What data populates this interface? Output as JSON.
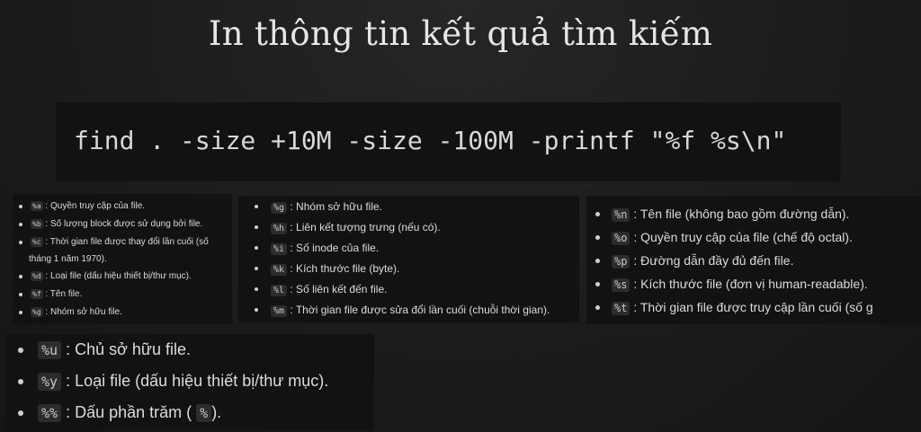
{
  "title": "In thông tin kết quả tìm kiếm",
  "command": "find . -size +10M -size -100M -printf \"%f %s\\n\"",
  "panel1": {
    "items": [
      {
        "code": "%a",
        "text": ": Quyền truy cập của file."
      },
      {
        "code": "%b",
        "text": ": Số lượng block được sử dụng bởi file."
      },
      {
        "code": "%c",
        "text": ": Thời gian file được thay đổi lần cuối (số",
        "cont": "tháng 1 năm 1970)."
      },
      {
        "code": "%d",
        "text": ": Loại file (dấu hiệu thiết bị/thư mục)."
      },
      {
        "code": "%f",
        "text": ": Tên file."
      },
      {
        "code": "%g",
        "text": ": Nhóm sở hữu file."
      }
    ]
  },
  "panel2": {
    "items": [
      {
        "code": "%g",
        "text": ": Nhóm sở hữu file."
      },
      {
        "code": "%h",
        "text": ": Liên kết tượng trưng (nếu có)."
      },
      {
        "code": "%i",
        "text": ": Số inode của file."
      },
      {
        "code": "%k",
        "text": ": Kích thước file (byte)."
      },
      {
        "code": "%l",
        "text": ": Số liên kết đến file."
      },
      {
        "code": "%m",
        "text": ": Thời gian file được sửa đổi lần cuối (chuỗi thời gian)."
      }
    ]
  },
  "panel3": {
    "items": [
      {
        "code": "%n",
        "text": ": Tên file (không bao gồm đường dẫn)."
      },
      {
        "code": "%o",
        "text": ": Quyền truy cập của file (chế độ octal)."
      },
      {
        "code": "%p",
        "text": ": Đường dẫn đầy đủ đến file."
      },
      {
        "code": "%s",
        "text": ": Kích thước file (đơn vị human-readable)."
      },
      {
        "code": "%t",
        "text": ": Thời gian file được truy cập lần cuối (số g"
      }
    ]
  },
  "panel4": {
    "items": [
      {
        "code": "%u",
        "text": ": Chủ sở hữu file."
      },
      {
        "code": "%y",
        "text": ": Loại file (dấu hiệu thiết bị/thư mục)."
      },
      {
        "code": "%%",
        "text": ": Dấu phần trăm (",
        "code2": "%",
        "text2": ")."
      }
    ]
  }
}
